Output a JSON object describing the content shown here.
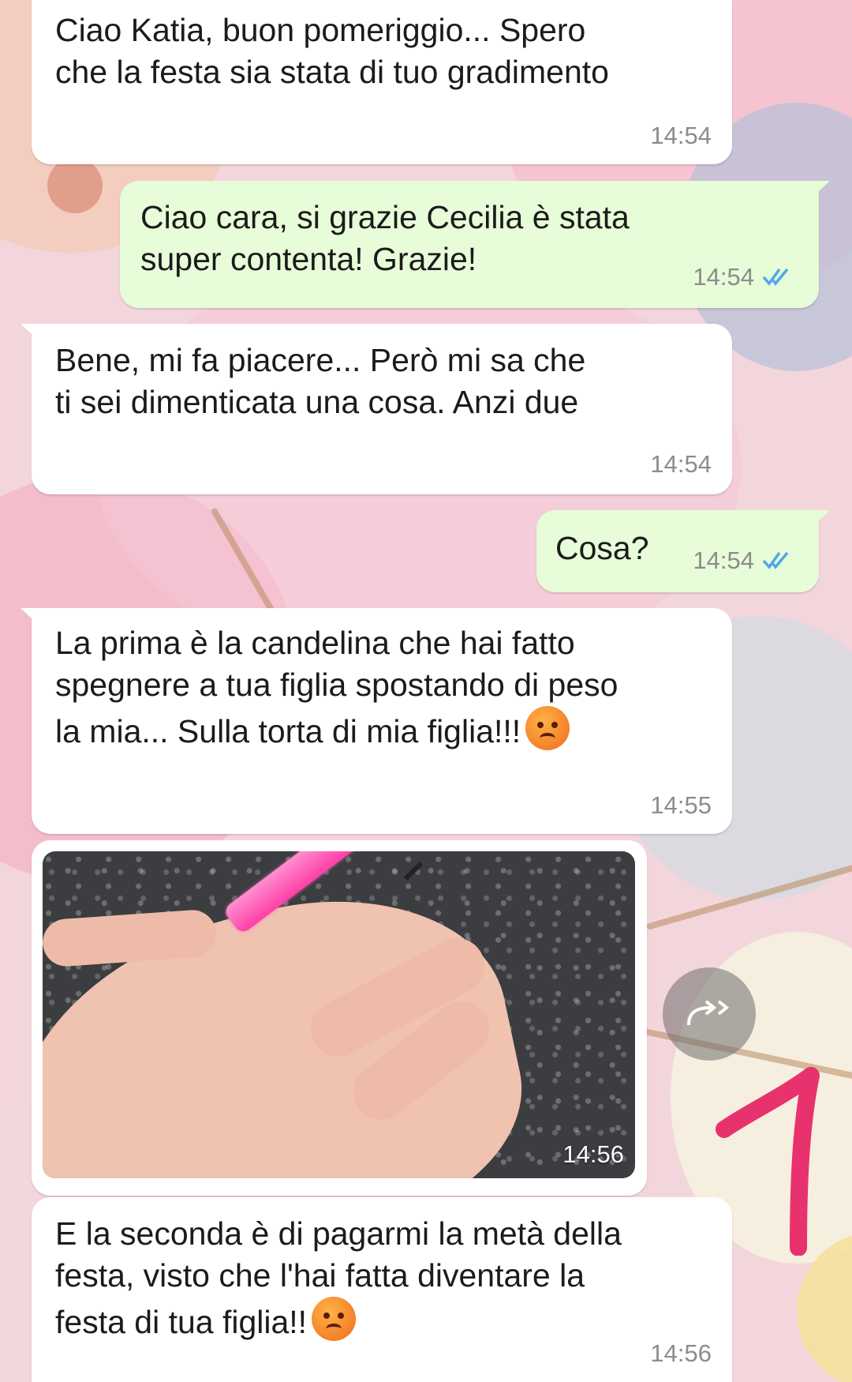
{
  "messages": [
    {
      "direction": "in",
      "text": "Ciao Katia, buon pomeriggio... Spero\nche la festa sia stata di tuo gradimento",
      "time": "14:54"
    },
    {
      "direction": "out",
      "text": "Ciao cara, si grazie Cecilia è stata\nsuper contenta! Grazie!",
      "time": "14:54",
      "status": "read"
    },
    {
      "direction": "in",
      "text": "Bene, mi fa piacere... Però mi sa che\nti sei dimenticata una cosa. Anzi due",
      "time": "14:54"
    },
    {
      "direction": "out",
      "text": "Cosa?",
      "time": "14:54",
      "status": "read"
    },
    {
      "direction": "in",
      "text_line1": "La prima è la candelina che hai fatto",
      "text_line2": "spegnere a tua figlia spostando di peso",
      "text_line3": "la mia... Sulla torta di mia figlia!!!",
      "emoji": "angry-face",
      "time": "14:55"
    },
    {
      "direction": "in",
      "type": "photo",
      "photo_subject": "hand holding pink candle",
      "time": "14:56"
    },
    {
      "direction": "in",
      "text_line1": "E la seconda è di pagarmi la metà della",
      "text_line2": "festa, visto che l'hai fatta diventare la",
      "text_line3": "festa di tua figlia!!",
      "emoji": "angry-face",
      "time": "14:56"
    }
  ],
  "colors": {
    "incoming_bubble": "#ffffff",
    "outgoing_bubble": "#e7fcd8",
    "read_tick": "#4fa8e8",
    "annotation": "#e8326e"
  },
  "icons": {
    "forward": "forward-icon",
    "read_receipt": "double-check-icon"
  }
}
